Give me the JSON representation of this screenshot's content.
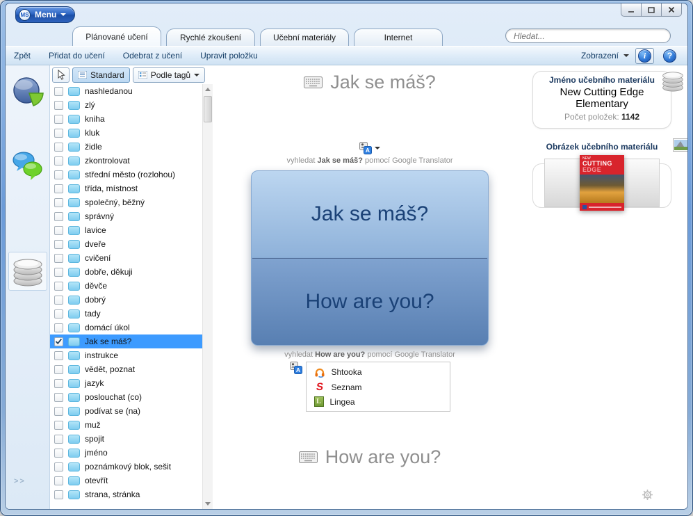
{
  "window": {
    "logo": "MS",
    "menu_label": "Menu"
  },
  "tabs": [
    {
      "label": "Plánované učení",
      "active": true
    },
    {
      "label": "Rychlé zkoušení",
      "active": false
    },
    {
      "label": "Učební materiály",
      "active": false
    },
    {
      "label": "Internet",
      "active": false
    }
  ],
  "search": {
    "placeholder": "Hledat..."
  },
  "toolbar": {
    "back": "Zpět",
    "add": "Přidat do učení",
    "remove": "Odebrat z učení",
    "edit": "Upravit položku",
    "view": "Zobrazení"
  },
  "icons": {
    "info": "i",
    "help": "?",
    "seznam": "S",
    "lingea": "L"
  },
  "list": {
    "toolbar": {
      "standard": "Standard",
      "by_tags": "Podle tagů"
    },
    "expander": ">>",
    "items": [
      {
        "label": "nashledanou"
      },
      {
        "label": "zlý"
      },
      {
        "label": "kniha"
      },
      {
        "label": "kluk"
      },
      {
        "label": "židle"
      },
      {
        "label": "zkontrolovat"
      },
      {
        "label": "střední město (rozlohou)"
      },
      {
        "label": "třída, místnost"
      },
      {
        "label": "společný, běžný"
      },
      {
        "label": "správný"
      },
      {
        "label": "lavice"
      },
      {
        "label": "dveře"
      },
      {
        "label": "cvičení"
      },
      {
        "label": "dobře, děkuji"
      },
      {
        "label": "děvče"
      },
      {
        "label": "dobrý"
      },
      {
        "label": "tady"
      },
      {
        "label": "domácí úkol"
      },
      {
        "label": "Jak se máš?",
        "checked": true,
        "selected": true
      },
      {
        "label": "instrukce"
      },
      {
        "label": "vědět, poznat"
      },
      {
        "label": "jazyk"
      },
      {
        "label": "poslouchat (co)"
      },
      {
        "label": "podívat se (na)"
      },
      {
        "label": "muž"
      },
      {
        "label": "spojit"
      },
      {
        "label": "jméno"
      },
      {
        "label": "poznámkový blok, sešit"
      },
      {
        "label": "otevřít"
      },
      {
        "label": "strana, stránka"
      }
    ]
  },
  "main": {
    "question_heading": "Jak se máš?",
    "answer_heading": "How are you?",
    "card": {
      "front": "Jak se máš?",
      "back": "How are you?"
    },
    "search_front": {
      "prefix": "vyhledat ",
      "term": "Jak se máš?",
      "suffix": " pomocí Google Translator"
    },
    "search_back": {
      "prefix": "vyhledat ",
      "term": "How are you?",
      "suffix": " pomocí Google Translator"
    },
    "dictionaries": [
      {
        "name": "Shtooka"
      },
      {
        "name": "Seznam"
      },
      {
        "name": "Lingea"
      }
    ]
  },
  "right_panel": {
    "name_label": "Jméno učebního materiálu",
    "material_name": "New Cutting Edge Elementary",
    "count_label": "Počet položek:",
    "count_value": "1142",
    "image_label": "Obrázek učebního materiálu",
    "book_cover": {
      "line1": "NEW",
      "line2": "CUTTING",
      "line3": "EDGE"
    }
  },
  "colors": {
    "selection": "#3d9bff",
    "card_top": "#bcd6f0",
    "card_bottom": "#587fb2",
    "frame_blue": "#6b9bd8",
    "accent_blue": "#2a62c0"
  }
}
